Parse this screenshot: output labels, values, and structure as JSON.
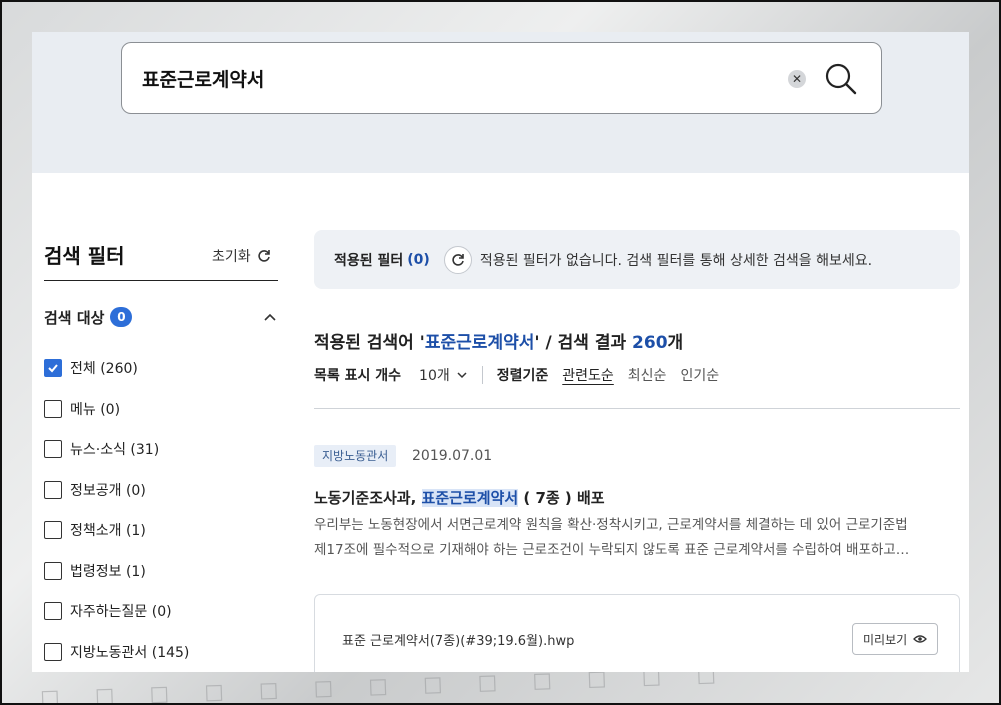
{
  "search": {
    "value": "표준근로계약서"
  },
  "filter": {
    "title": "검색 필터",
    "reset_label": "초기화",
    "target_label": "검색 대상",
    "target_count": "0",
    "items": [
      {
        "label": "전체 (260)",
        "checked": true
      },
      {
        "label": "메뉴 (0)",
        "checked": false
      },
      {
        "label": "뉴스·소식 (31)",
        "checked": false
      },
      {
        "label": "정보공개 (0)",
        "checked": false
      },
      {
        "label": "정책소개 (1)",
        "checked": false
      },
      {
        "label": "법령정보 (1)",
        "checked": false
      },
      {
        "label": "자주하는질문 (0)",
        "checked": false
      },
      {
        "label": "지방노동관서 (145)",
        "checked": false
      }
    ]
  },
  "applied": {
    "label": "적용된 필터",
    "count": "(0)",
    "message": "적용된 필터가 없습니다. 검색 필터를 통해 상세한 검색을 해보세요."
  },
  "summary": {
    "prefix": "적용된 검색어 '",
    "keyword": "표준근로계약서",
    "middle": "' / 검색 결과 ",
    "count": "260",
    "suffix": "개"
  },
  "controls": {
    "page_size_label": "목록 표시 개수",
    "page_size_value": "10개",
    "sort_label": "정렬기준",
    "sort_options": [
      "관련도순",
      "최신순",
      "인기순"
    ]
  },
  "result": {
    "category": "지방노동관서",
    "date": "2019.07.01",
    "title_before": "노동기준조사과, ",
    "title_highlight": "표준근로계약서",
    "title_after": " ( 7종 ) 배포",
    "desc_line1": "우리부는 노동현장에서 서면근로계약 원칙을 확산·정착시키고, 근로계약서를 체결하는 데 있어 근로기준법",
    "desc_line2": "제17조에 필수적으로 기재해야 하는 근로조건이 누락되지 않도록 표준 근로계약서를 수립하여 배포하고…",
    "attachment": "표준 근로계약서(7종)(#39;19.6월).hwp",
    "preview_label": "미리보기"
  },
  "colors": {
    "accent": "#2d6ed8",
    "highlight_text": "#1d4fa8",
    "search_band": "#e9edf2"
  }
}
